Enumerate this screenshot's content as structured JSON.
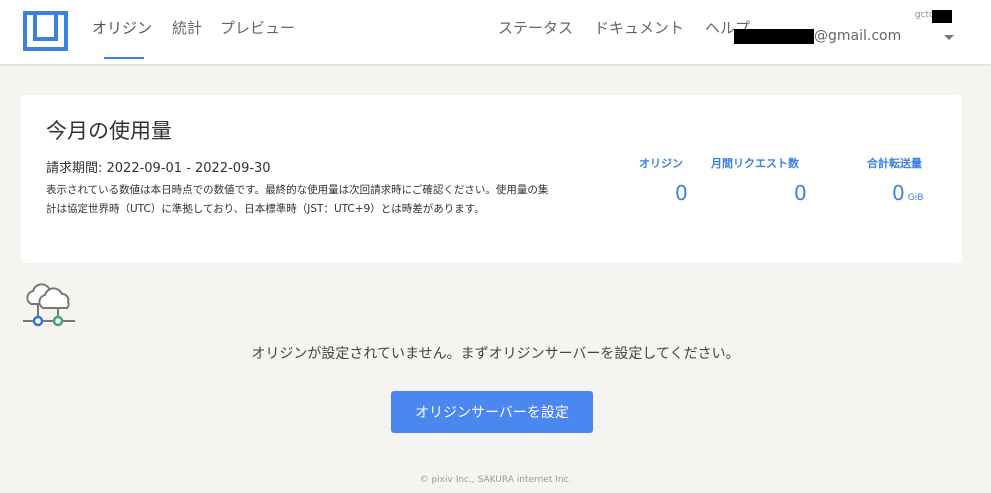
{
  "header": {
    "nav": [
      {
        "label": "オリジン"
      },
      {
        "label": "統計"
      },
      {
        "label": "プレビュー"
      }
    ],
    "right_links": [
      {
        "label": "ステータス"
      },
      {
        "label": "ドキュメント"
      },
      {
        "label": "ヘルプ"
      }
    ],
    "account": {
      "name_prefix": "gctc",
      "email_suffix": "@gmail.com"
    }
  },
  "usage": {
    "title": "今月の使用量",
    "billing_period": "請求期間: 2022-09-01 - 2022-09-30",
    "note": "表示されている数値は本日時点での数値です。最終的な使用量は次回請求時にご確認ください。使用量の集計は協定世界時（UTC）に準拠しており、日本標準時（JST：UTC+9）とは時差があります。",
    "stats": [
      {
        "label": "オリジン",
        "value": "0",
        "unit": ""
      },
      {
        "label": "月間リクエスト数",
        "value": "0",
        "unit": ""
      },
      {
        "label": "合計転送量",
        "value": "0",
        "unit": "GiB"
      }
    ]
  },
  "empty_state": {
    "message": "オリジンが設定されていません。まずオリジンサーバーを設定してください。",
    "button_label": "オリジンサーバーを設定"
  },
  "footer": {
    "copyright": "© pixiv Inc., SAKURA internet Inc."
  },
  "colors": {
    "accent": "#3b82e0",
    "button": "#4a88f0",
    "background": "#f5f4f0"
  }
}
